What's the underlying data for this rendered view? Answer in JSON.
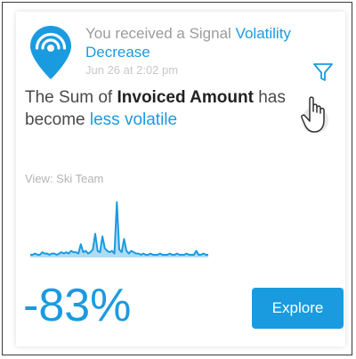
{
  "notification": {
    "prefix": "You received a Signal",
    "signal_type_part1": "Volatility",
    "signal_type_part2": "Decrease",
    "timestamp": "Jun 26 at 2:02 pm"
  },
  "headline": {
    "part1": "The Sum of ",
    "measure": "Invoiced Amount",
    "part2": " has become ",
    "change": "less volatile"
  },
  "view_label": "View: Ski Team",
  "change_percent": "-83%",
  "explore_label": "Explore",
  "icons": {
    "pin": "location-pin-signal-icon",
    "filter": "funnel-filter-icon",
    "cursor": "hand-pointer-cursor"
  },
  "colors": {
    "accent": "#1a9be0",
    "muted_text": "#9b9b9b",
    "body_text": "#4a4a4a"
  },
  "sparkline": {
    "values": [
      2,
      2,
      3,
      2,
      2,
      4,
      3,
      3,
      2,
      3,
      3,
      2,
      3,
      4,
      3,
      4,
      3,
      5,
      4,
      4,
      3,
      10,
      4,
      5,
      3,
      4,
      6,
      18,
      5,
      4,
      16,
      7,
      5,
      4,
      5,
      3,
      42,
      6,
      4,
      14,
      5,
      3,
      5,
      4,
      3,
      3,
      2,
      3,
      2,
      2,
      3,
      2,
      2,
      2,
      3,
      2,
      2,
      2,
      3,
      2,
      2,
      3,
      2,
      2,
      2,
      3,
      2,
      2,
      2,
      5,
      2,
      2,
      3,
      2,
      2
    ]
  }
}
